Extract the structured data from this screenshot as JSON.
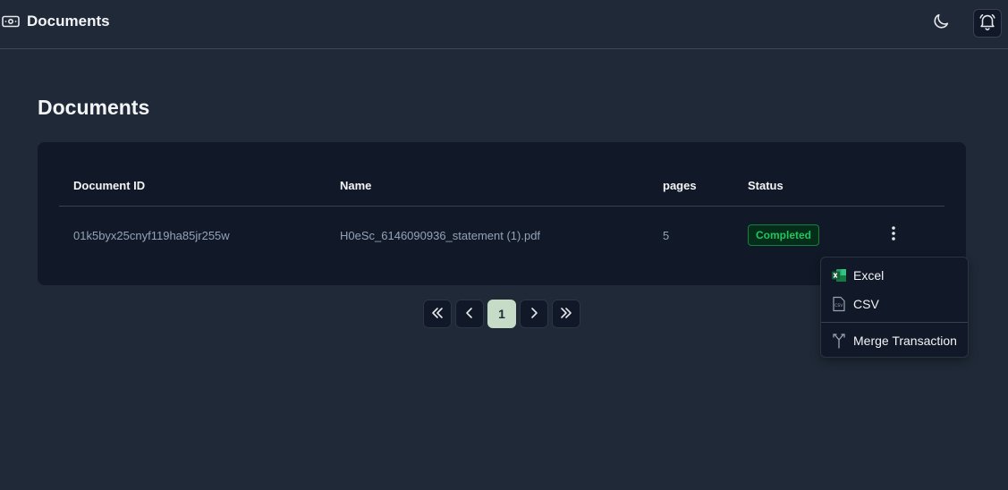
{
  "header": {
    "title": "Documents",
    "icons": {
      "brand": "cash-icon",
      "theme": "moon-icon",
      "notifications": "bell-icon"
    }
  },
  "page": {
    "title": "Documents"
  },
  "table": {
    "columns": [
      "Document ID",
      "Name",
      "pages",
      "Status"
    ],
    "rows": [
      {
        "document_id": "01k5byx25cnyf119ha85jr255w",
        "name": "H0eSc_6146090936_statement (1).pdf",
        "pages": "5",
        "status": "Completed"
      }
    ]
  },
  "pagination": {
    "current_page": "1"
  },
  "row_menu": {
    "items": [
      {
        "label": "Excel",
        "icon": "excel-icon"
      },
      {
        "label": "CSV",
        "icon": "csv-icon"
      },
      {
        "label": "Merge Transaction",
        "icon": "merge-icon"
      }
    ]
  },
  "colors": {
    "background": "#1f2937",
    "card": "#111827",
    "status_green": "#22c55e",
    "active_page": "#c7dcc6"
  }
}
